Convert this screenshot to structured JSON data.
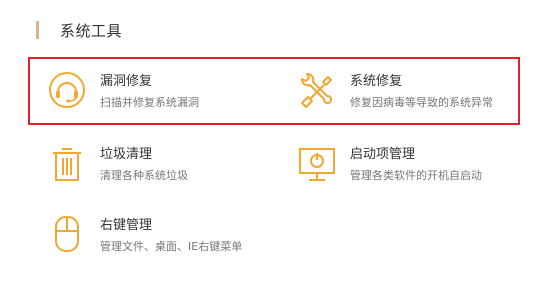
{
  "section": {
    "title": "系统工具"
  },
  "colors": {
    "accent": "#d4b48a",
    "icon": "#f0a830",
    "highlight_border": "#e2202a"
  },
  "tools": [
    {
      "name": "漏洞修复",
      "desc": "扫描并修复系统漏洞",
      "icon": "headset-shield-icon"
    },
    {
      "name": "系统修复",
      "desc": "修复因病毒等导致的系统异常",
      "icon": "wrench-screwdriver-icon"
    },
    {
      "name": "垃圾清理",
      "desc": "清理各种系统垃圾",
      "icon": "trash-can-icon"
    },
    {
      "name": "启动项管理",
      "desc": "管理各类软件的开机自启动",
      "icon": "monitor-power-icon"
    },
    {
      "name": "右键管理",
      "desc": "管理文件、桌面、IE右键菜单",
      "icon": "mouse-icon"
    }
  ]
}
